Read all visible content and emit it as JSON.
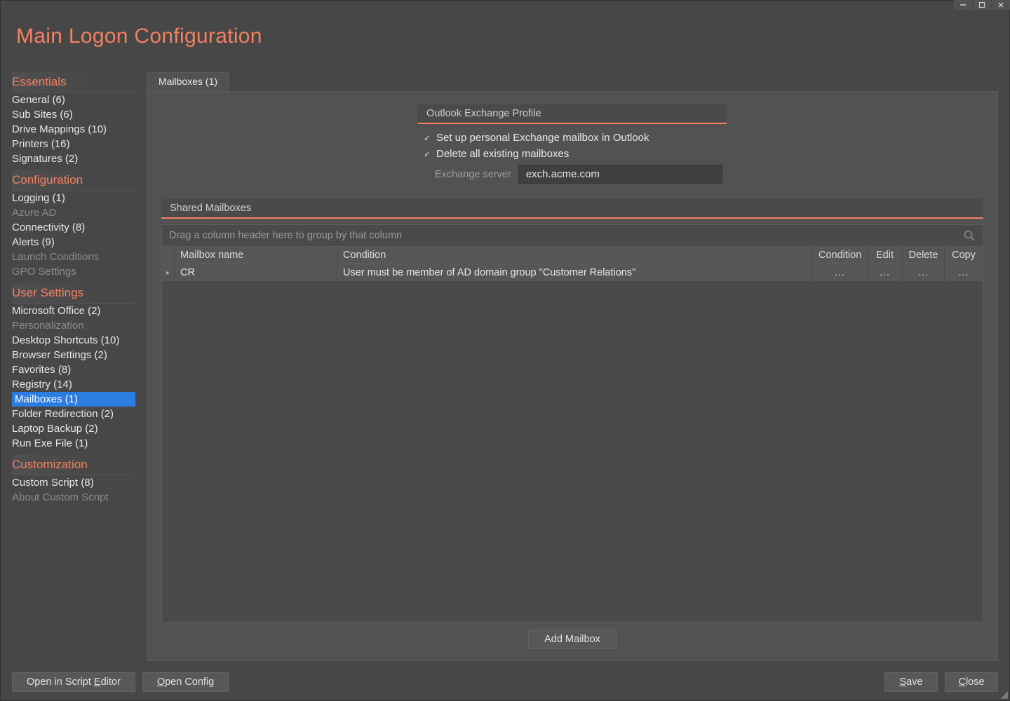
{
  "titlebar": {
    "min": "—",
    "max": "▢",
    "close": "✕"
  },
  "page_title": "Main Logon Configuration",
  "sidebar": {
    "sections": [
      {
        "header": "Essentials",
        "items": [
          {
            "label": "General (6)",
            "state": "normal"
          },
          {
            "label": "Sub Sites (6)",
            "state": "normal"
          },
          {
            "label": "Drive Mappings (10)",
            "state": "normal"
          },
          {
            "label": "Printers (16)",
            "state": "normal"
          },
          {
            "label": "Signatures (2)",
            "state": "normal"
          }
        ]
      },
      {
        "header": "Configuration",
        "items": [
          {
            "label": "Logging (1)",
            "state": "normal"
          },
          {
            "label": "Azure AD",
            "state": "disabled"
          },
          {
            "label": "Connectivity (8)",
            "state": "normal"
          },
          {
            "label": "Alerts (9)",
            "state": "normal"
          },
          {
            "label": "Launch Conditions",
            "state": "disabled"
          },
          {
            "label": "GPO Settings",
            "state": "disabled"
          }
        ]
      },
      {
        "header": "User Settings",
        "items": [
          {
            "label": "Microsoft Office (2)",
            "state": "normal"
          },
          {
            "label": "Personalization",
            "state": "disabled"
          },
          {
            "label": "Desktop Shortcuts (10)",
            "state": "normal"
          },
          {
            "label": "Browser Settings (2)",
            "state": "normal"
          },
          {
            "label": "Favorites (8)",
            "state": "normal"
          },
          {
            "label": "Registry (14)",
            "state": "normal"
          },
          {
            "label": "Mailboxes (1)",
            "state": "selected"
          },
          {
            "label": "Folder Redirection (2)",
            "state": "normal"
          },
          {
            "label": "Laptop Backup (2)",
            "state": "normal"
          },
          {
            "label": "Run Exe File (1)",
            "state": "normal"
          }
        ]
      },
      {
        "header": "Customization",
        "items": [
          {
            "label": "Custom Script (8)",
            "state": "normal"
          },
          {
            "label": "About Custom Script",
            "state": "disabled"
          }
        ]
      }
    ]
  },
  "tab": {
    "label": "Mailboxes (1)"
  },
  "profile": {
    "section_title": "Outlook Exchange Profile",
    "chk_setup": "Set up personal Exchange mailbox in Outlook",
    "chk_delete": "Delete all existing mailboxes",
    "server_label": "Exchange server",
    "server_value": "exch.acme.com"
  },
  "shared": {
    "section_title": "Shared Mailboxes",
    "group_hint": "Drag a column header here to group by that column",
    "columns": {
      "name": "Mailbox name",
      "condition_text": "Condition",
      "condition": "Condition",
      "edit": "Edit",
      "delete": "Delete",
      "copy": "Copy"
    },
    "rows": [
      {
        "name": "CR",
        "condition_text": "User must be member of AD domain group \"Customer Relations\"",
        "condition": "...",
        "edit": "...",
        "delete": "...",
        "copy": "..."
      }
    ],
    "add_button": "Add Mailbox"
  },
  "footer": {
    "open_script": "Open in Script Editor",
    "open_config": "Open Config",
    "save": "Save",
    "close": "Close"
  }
}
